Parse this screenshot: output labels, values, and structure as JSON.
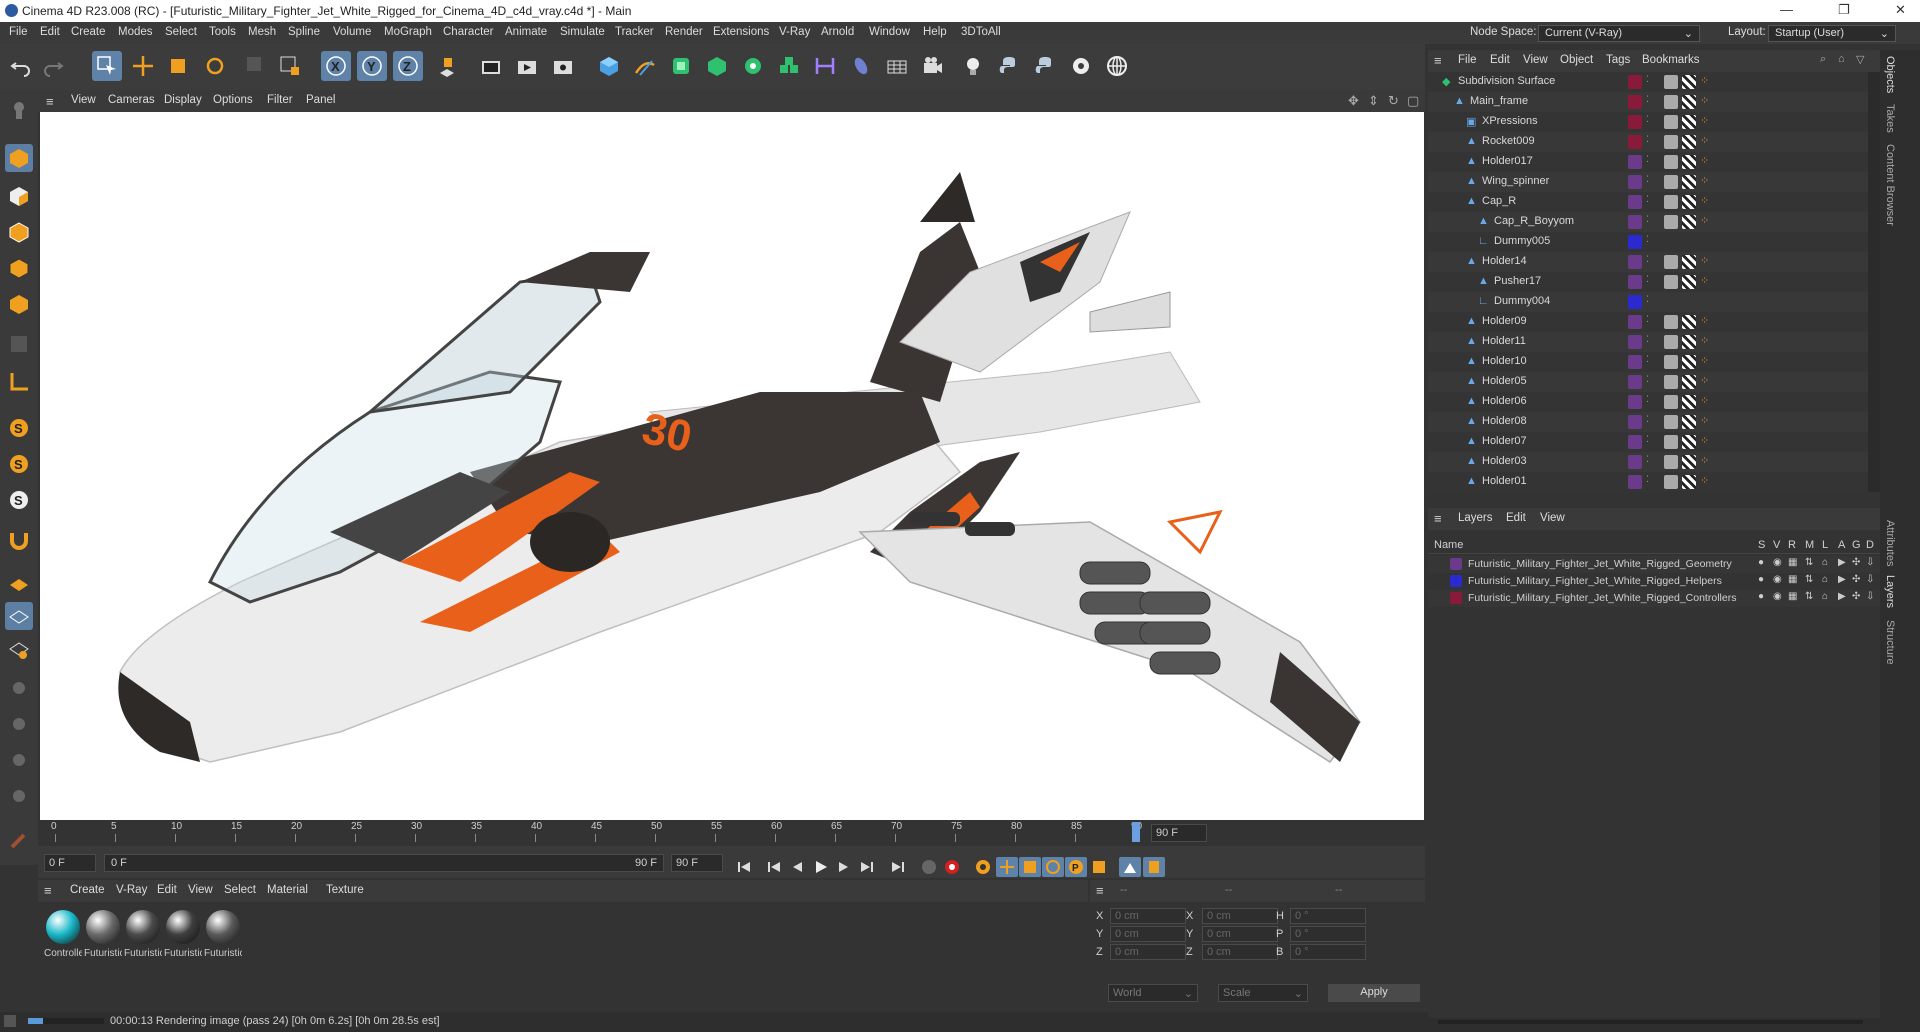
{
  "window": {
    "title": "Cinema 4D R23.008 (RC) - [Futuristic_Military_Fighter_Jet_White_Rigged_for_Cinema_4D_c4d_vray.c4d *] - Main",
    "controls": [
      "—",
      "❐",
      "✕"
    ]
  },
  "menu": [
    "File",
    "Edit",
    "Create",
    "Modes",
    "Select",
    "Tools",
    "Mesh",
    "Spline",
    "Volume",
    "MoGraph",
    "Character",
    "Animate",
    "Simulate",
    "Tracker",
    "Render",
    "Extensions",
    "V-Ray",
    "Arnold",
    "Window",
    "Help",
    "3DToAll"
  ],
  "nodespace": {
    "label": "Node Space:",
    "value": "Current (V-Ray)"
  },
  "layout": {
    "label": "Layout:",
    "value": "Startup (User)"
  },
  "viewport_menu": [
    "View",
    "Cameras",
    "Display",
    "Options",
    "Filter",
    "Panel"
  ],
  "timeline": {
    "ticks": [
      "0",
      "5",
      "10",
      "15",
      "20",
      "25",
      "30",
      "35",
      "40",
      "45",
      "50",
      "55",
      "60",
      "65",
      "70",
      "75",
      "80",
      "85",
      "90"
    ],
    "end_label": "90 F",
    "current_frame": 90,
    "max_frame": 90
  },
  "frames": {
    "start": "0 F",
    "current": "0 F",
    "end": "90 F",
    "end2": "90 F"
  },
  "material_menu": [
    "Create",
    "V-Ray",
    "Edit",
    "View",
    "Select",
    "Material",
    "Texture"
  ],
  "materials": [
    {
      "label": "Controlle",
      "color": "#19b8c8"
    },
    {
      "label": "Futuristic",
      "color": "#6a6a6a"
    },
    {
      "label": "Futuristic",
      "color": "#4a4a4a"
    },
    {
      "label": "Futuristic",
      "color": "#3e3e3e"
    },
    {
      "label": "Futuristic",
      "color": "#5a5a5a"
    }
  ],
  "coords": {
    "headers": [
      "--",
      "--",
      "--"
    ],
    "rows": [
      {
        "a": "X",
        "av": "0 cm",
        "b": "X",
        "bv": "0 cm",
        "c": "H",
        "cv": "0 °"
      },
      {
        "a": "Y",
        "av": "0 cm",
        "b": "Y",
        "bv": "0 cm",
        "c": "P",
        "cv": "0 °"
      },
      {
        "a": "Z",
        "av": "0 cm",
        "b": "Z",
        "bv": "0 cm",
        "c": "B",
        "cv": "0 °"
      }
    ],
    "world": "World",
    "scale": "Scale",
    "apply": "Apply"
  },
  "status": "00:00:13 Rendering image (pass 24) [0h  0m  6.2s] [0h  0m 28.5s est]",
  "objects": {
    "menu": [
      "File",
      "Edit",
      "View",
      "Object",
      "Tags",
      "Bookmarks"
    ],
    "items": [
      {
        "name": "Subdivision Surface",
        "indent": 0
      },
      {
        "name": "Main_frame",
        "indent": 1
      },
      {
        "name": "XPressions",
        "indent": 2
      },
      {
        "name": "Rocket009",
        "indent": 2
      },
      {
        "name": "Holder017",
        "indent": 2
      },
      {
        "name": "Wing_spinner",
        "indent": 2
      },
      {
        "name": "Cap_R",
        "indent": 2
      },
      {
        "name": "Cap_R_Boyyom",
        "indent": 3
      },
      {
        "name": "Dummy005",
        "indent": 3
      },
      {
        "name": "Holder14",
        "indent": 2
      },
      {
        "name": "Pusher17",
        "indent": 3
      },
      {
        "name": "Dummy004",
        "indent": 3
      },
      {
        "name": "Holder09",
        "indent": 2
      },
      {
        "name": "Holder11",
        "indent": 2
      },
      {
        "name": "Holder10",
        "indent": 2
      },
      {
        "name": "Holder05",
        "indent": 2
      },
      {
        "name": "Holder06",
        "indent": 2
      },
      {
        "name": "Holder08",
        "indent": 2
      },
      {
        "name": "Holder07",
        "indent": 2
      },
      {
        "name": "Holder03",
        "indent": 2
      },
      {
        "name": "Holder01",
        "indent": 2
      }
    ]
  },
  "layers": {
    "menu": [
      "Layers",
      "Edit",
      "View"
    ],
    "columns": [
      "Name",
      "S",
      "V",
      "R",
      "M",
      "L",
      "A",
      "G",
      "D"
    ],
    "items": [
      {
        "name": "Futuristic_Military_Fighter_Jet_White_Rigged_Geometry",
        "color": "#6b3a8a"
      },
      {
        "name": "Futuristic_Military_Fighter_Jet_White_Rigged_Helpers",
        "color": "#2a2ad0"
      },
      {
        "name": "Futuristic_Military_Fighter_Jet_White_Rigged_Controllers",
        "color": "#8a1a3a"
      }
    ]
  },
  "right_tabs": [
    "Objects",
    "Takes",
    "Content Browser",
    "Attributes",
    "Layers",
    "Structure"
  ],
  "jet_text": {
    "number": "30"
  }
}
